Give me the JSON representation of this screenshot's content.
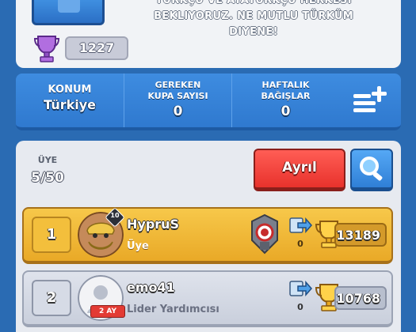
{
  "clan_header": {
    "description_lines": [
      "TÜRKÇÜ VE ATATÜRKÇÜ HERKESI",
      "BEKLIYORUZ. NE MUTLU TÜRKÜM",
      "DIYENE!"
    ],
    "required_trophies_top": "1227"
  },
  "info_bar": {
    "location_label": "KONUM",
    "location_value": "Türkiye",
    "required_label_1": "GEREKEN",
    "required_label_2": "KUPA SAYISI",
    "required_value": "0",
    "donations_label_1": "HAFTALIK",
    "donations_label_2": "BAĞIŞLAR",
    "donations_value": "0",
    "menu_icon": "list-add-icon"
  },
  "members": {
    "count_label": "ÜYE",
    "count_value": "5/50",
    "leave_label": "Ayrıl",
    "search_icon": "search-icon",
    "rows": [
      {
        "rank": "1",
        "level": "10",
        "name": "HypruS",
        "role": "Üye",
        "tenure": "",
        "donations": "0",
        "trophies": "13189"
      },
      {
        "rank": "2",
        "level": "",
        "name": "emo41",
        "role": "Lider Yardımcısı",
        "tenure": "2 AY",
        "donations": "0",
        "trophies": "10768"
      }
    ]
  },
  "colors": {
    "background": "#2a6bb3",
    "gold_row": "#f1b93a",
    "leave_button": "#f0403a",
    "search_button": "#3d8fe3"
  }
}
